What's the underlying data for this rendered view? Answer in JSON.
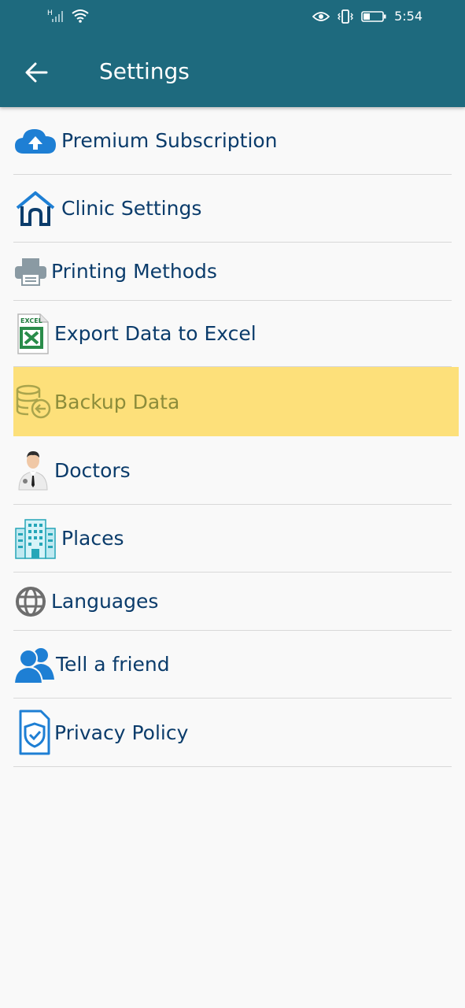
{
  "status_bar": {
    "time": "5:54",
    "sim_label": "H"
  },
  "header": {
    "title": "Settings",
    "background": "#1e6a7e"
  },
  "menu": {
    "items": [
      {
        "label": "Premium Subscription",
        "icon": "cloud-upload-icon"
      },
      {
        "label": "Clinic Settings",
        "icon": "house-icon"
      },
      {
        "label": "Printing Methods",
        "icon": "printer-icon"
      },
      {
        "label": "Export Data to Excel",
        "icon": "excel-icon"
      },
      {
        "label": "Backup Data",
        "icon": "database-backup-icon",
        "highlighted": true
      },
      {
        "label": "Doctors",
        "icon": "doctor-icon"
      },
      {
        "label": "Places",
        "icon": "building-icon"
      },
      {
        "label": "Languages",
        "icon": "globe-icon"
      },
      {
        "label": "Tell a friend",
        "icon": "people-icon"
      },
      {
        "label": "Privacy Policy",
        "icon": "shield-document-icon"
      }
    ]
  },
  "colors": {
    "label": "#0b3c6b",
    "highlight_bg": "#fde07a",
    "highlight_text": "#8c8c3a"
  }
}
